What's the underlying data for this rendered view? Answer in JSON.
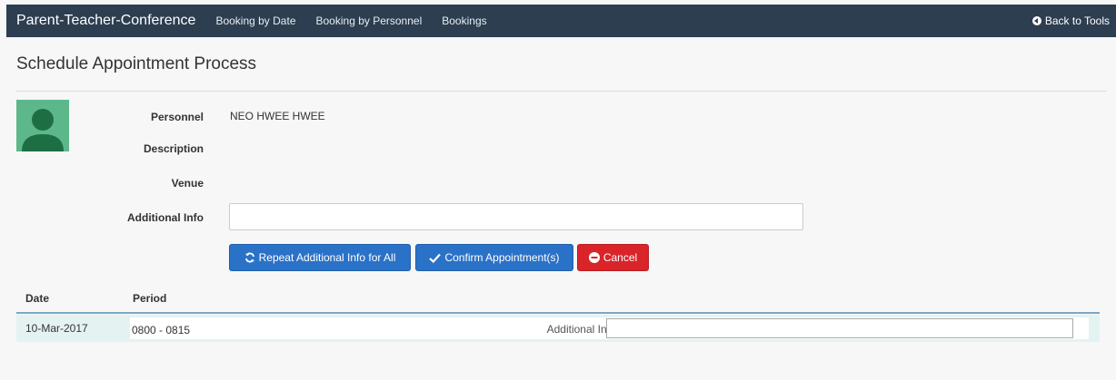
{
  "navbar": {
    "brand": "Parent-Teacher-Conference",
    "links": [
      "Booking by Date",
      "Booking by Personnel",
      "Bookings"
    ],
    "back_label": "Back to Tools"
  },
  "page": {
    "title": "Schedule Appointment Process"
  },
  "form": {
    "personnel_label": "Personnel",
    "personnel_value": "NEO HWEE HWEE",
    "description_label": "Description",
    "description_value": "",
    "venue_label": "Venue",
    "venue_value": "",
    "additional_info_label": "Additional Info",
    "additional_info_value": ""
  },
  "buttons": {
    "repeat": "Repeat Additional Info for All",
    "confirm": "Confirm Appointment(s)",
    "cancel": "Cancel"
  },
  "table": {
    "headers": {
      "date": "Date",
      "period": "Period"
    },
    "rows": [
      {
        "date": "10-Mar-2017",
        "period": "0800 - 0815",
        "ai_label": "Additional Info:",
        "ai_value": ""
      }
    ]
  },
  "colors": {
    "navbar": "#2c3e50",
    "primary": "#2a72c8",
    "danger": "#d9252a",
    "avatar": "#5cb88a",
    "row_highlight": "#e5f2f2"
  }
}
